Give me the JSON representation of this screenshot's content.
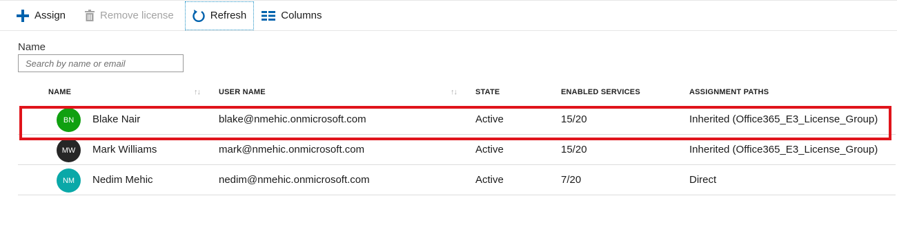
{
  "toolbar": {
    "assign": "Assign",
    "remove_license": "Remove license",
    "refresh": "Refresh",
    "columns": "Columns"
  },
  "filter": {
    "label": "Name",
    "placeholder": "Search by name or email"
  },
  "columns": [
    "NAME",
    "USER NAME",
    "STATE",
    "ENABLED SERVICES",
    "ASSIGNMENT PATHS"
  ],
  "rows": [
    {
      "initials": "BN",
      "avatar_color": "#10a010",
      "name": "Blake Nair",
      "username": "blake@nmehic.onmicrosoft.com",
      "state": "Active",
      "services": "15/20",
      "path": "Inherited (Office365_E3_License_Group)",
      "highlighted": true
    },
    {
      "initials": "MW",
      "avatar_color": "#262626",
      "name": "Mark Williams",
      "username": "mark@nmehic.onmicrosoft.com",
      "state": "Active",
      "services": "15/20",
      "path": "Inherited (Office365_E3_License_Group)",
      "highlighted": false
    },
    {
      "initials": "NM",
      "avatar_color": "#0aa8a8",
      "name": "Nedim Mehic",
      "username": "nedim@nmehic.onmicrosoft.com",
      "state": "Active",
      "services": "7/20",
      "path": "Direct",
      "highlighted": false
    }
  ],
  "colors": {
    "accent": "#0062ad",
    "highlight": "#e0141b"
  }
}
